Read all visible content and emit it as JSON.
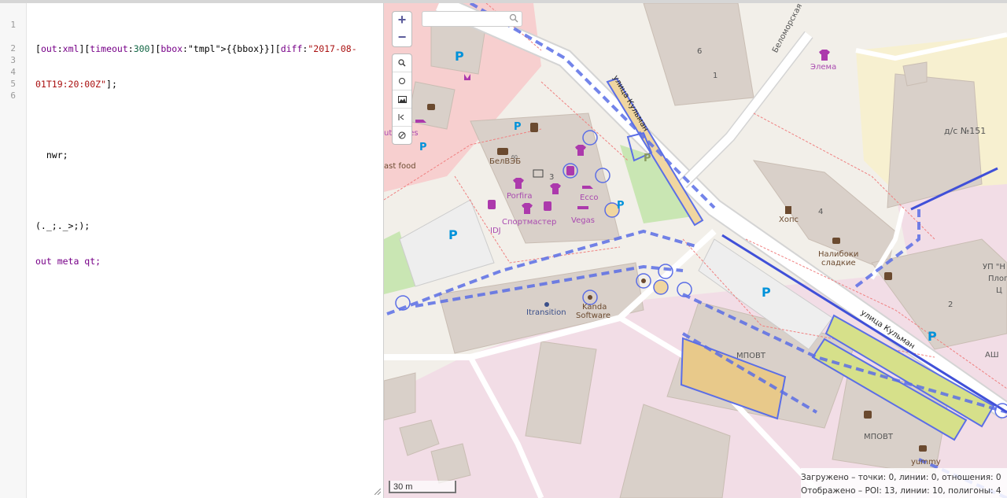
{
  "editor": {
    "lines": [
      {
        "num": "1",
        "text": "[out:xml][timeout:300][bbox:{{bbox}}][diff:\"2017-08-"
      },
      {
        "num": "",
        "text": "01T19:20:00Z\"];"
      },
      {
        "num": "2",
        "text": ""
      },
      {
        "num": "3",
        "text": "  nwr;"
      },
      {
        "num": "4",
        "text": ""
      },
      {
        "num": "5",
        "text": "(._;._>;);"
      },
      {
        "num": "6",
        "text": "out meta qt;"
      }
    ]
  },
  "map": {
    "zoom_in_label": "+",
    "zoom_out_label": "−",
    "search_placeholder": "",
    "tools": [
      "search-icon",
      "circle-icon",
      "image-icon",
      "first-icon",
      "cancel-icon"
    ],
    "labels": {
      "street_belomorskaya": "Беломорская у",
      "street_kulman_1": "улица Кульман",
      "street_kulman_2": "улица Кульман",
      "elema": "Элема",
      "ds151": "д/с №151",
      "belveb": "БелВЭБ",
      "cut_shoes": "ut Shoes",
      "fast_food": "ast food",
      "porfira": "Porfira",
      "ecco": "Ecco",
      "sportmaster": "Спортмастер",
      "vegas": "Vegas",
      "idj": "IDJ",
      "khops": "Хопс",
      "nalibo_1": "Налибоки",
      "nalibo_2": "сладкие",
      "up_1": "УП \"Н",
      "up_2": "Плог",
      "up_3": "Ц",
      "itransition": "Itransition",
      "kanda_1": "Kanda",
      "kanda_2": "Software",
      "mpovt_1": "МПОВТ",
      "mpovt_2": "МПОВТ",
      "yummy": "yummy",
      "ashi": "АШ",
      "n6": "6",
      "n1": "1",
      "n3": "3",
      "n4": "4",
      "n2": "2"
    },
    "scale_label": "30 m",
    "stats_loaded": "Загружено – точки: 0, линии: 0, отношения: 0",
    "stats_shown": "Отображено – POI: 13, линии: 10, полигоны: 4",
    "colors": {
      "overlay_line": "#5b6ee6",
      "building": "#d9d0c9",
      "landuse_pink": "#f2dde6",
      "road": "#ffffff",
      "poi_purple": "#ac39ac",
      "park_blue": "#0092da"
    }
  }
}
